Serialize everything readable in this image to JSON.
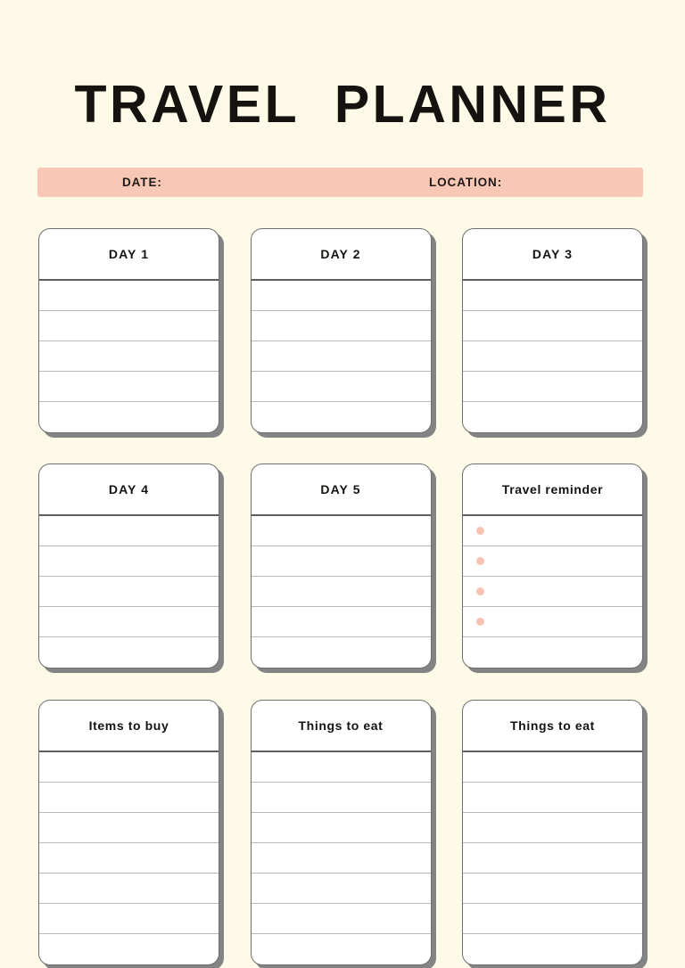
{
  "page": {
    "title": "TRAVEL  PLANNER",
    "background_color": "#fdfbe8",
    "accent_color": "#f9c7b6",
    "card_border_color": "#6f6f6f",
    "shadow_color": "#848484",
    "text_color": "#15120f"
  },
  "infobar": {
    "date_label": "DATE:",
    "location_label": "LOCATION:",
    "background_color": "#f9c7b6"
  },
  "cards": [
    {
      "id": "day-1",
      "title": "DAY 1",
      "style": "caps",
      "line_count": 5,
      "bullets": false,
      "size": "short"
    },
    {
      "id": "day-2",
      "title": "DAY 2",
      "style": "caps",
      "line_count": 5,
      "bullets": false,
      "size": "short"
    },
    {
      "id": "day-3",
      "title": "DAY 3",
      "style": "caps",
      "line_count": 5,
      "bullets": false,
      "size": "short"
    },
    {
      "id": "day-4",
      "title": "DAY 4",
      "style": "caps",
      "line_count": 5,
      "bullets": false,
      "size": "short"
    },
    {
      "id": "day-5",
      "title": "DAY 5",
      "style": "caps",
      "line_count": 5,
      "bullets": false,
      "size": "short"
    },
    {
      "id": "travel-reminder",
      "title": "Travel reminder",
      "style": "sentence",
      "line_count": 5,
      "bullets": true,
      "bullet_count": 4,
      "bullet_color": "#f7c3b2",
      "size": "short"
    },
    {
      "id": "items-to-buy",
      "title": "Items to buy",
      "style": "sentence",
      "line_count": 7,
      "bullets": false,
      "size": "tall"
    },
    {
      "id": "things-to-eat-1",
      "title": "Things to eat",
      "style": "sentence",
      "line_count": 7,
      "bullets": false,
      "size": "tall"
    },
    {
      "id": "things-to-eat-2",
      "title": "Things to eat",
      "style": "sentence",
      "line_count": 7,
      "bullets": false,
      "size": "tall"
    }
  ]
}
